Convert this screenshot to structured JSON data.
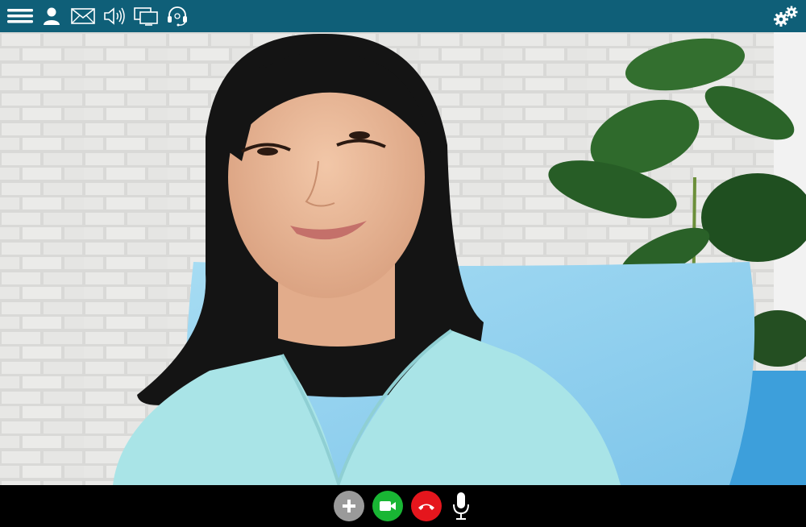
{
  "app": {
    "title": "",
    "stock_id": "376653038"
  },
  "toolbar": {
    "items": [
      {
        "icon": "menu-icon"
      },
      {
        "icon": "user-icon"
      },
      {
        "icon": "mail-icon"
      },
      {
        "icon": "speaker-icon"
      },
      {
        "icon": "screen-share-icon"
      },
      {
        "icon": "headset-icon"
      }
    ],
    "settings_icon": "gears-icon"
  },
  "video_feed": {
    "description_icon": "participant-video",
    "colors": {
      "wall": "#e4e4e2",
      "shirt": "#a6e3e6",
      "pillow": "#8fd3ef",
      "sofa": "#3ea0dc",
      "plant": "#2d5f2a"
    }
  },
  "controls": {
    "buttons": [
      {
        "icon": "plus-icon",
        "color": "#9a9a9a"
      },
      {
        "icon": "video-camera-icon",
        "color": "#19b634"
      },
      {
        "icon": "end-call-icon",
        "color": "#e5161d"
      },
      {
        "icon": "microphone-icon",
        "color": "#ffffff"
      }
    ]
  },
  "colors": {
    "toolbar": "#0f5f78",
    "bottombar": "#000000",
    "icon": "#ffffff"
  }
}
